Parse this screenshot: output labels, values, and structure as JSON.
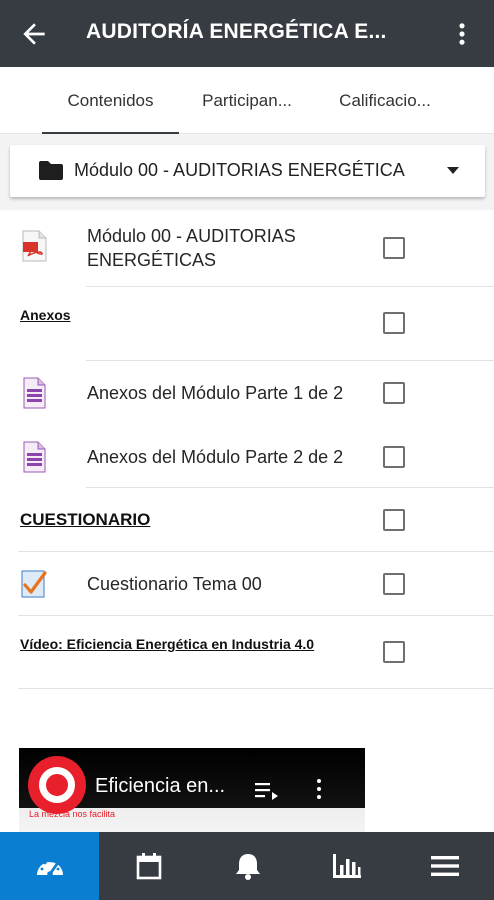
{
  "appbar": {
    "title": "AUDITORÍA ENERGÉTICA E...",
    "back_icon": "arrow-left-icon",
    "more_icon": "more-vertical-icon"
  },
  "tabs": [
    {
      "label": "Contenidos",
      "active": true
    },
    {
      "label": "Participan...",
      "active": false
    },
    {
      "label": "Calificacio...",
      "active": false
    }
  ],
  "section_selector": {
    "icon": "folder-icon",
    "label": "Módulo 00 - AUDITORIAS ENERGÉTICA",
    "caret_icon": "caret-down-icon"
  },
  "items": [
    {
      "type": "file",
      "icon": "pdf-file-icon",
      "line1": "Módulo 00 - AUDITORIAS",
      "line2": "ENERGÉTICAS",
      "checked": false
    },
    {
      "type": "label",
      "text": "Anexos",
      "checked": false
    },
    {
      "type": "file",
      "icon": "document-file-icon",
      "text": "Anexos del Módulo Parte 1 de 2",
      "checked": false
    },
    {
      "type": "file",
      "icon": "document-file-icon",
      "text": "Anexos del Módulo Parte 2 de 2",
      "checked": false
    },
    {
      "type": "label",
      "text": "CUESTIONARIO",
      "checked": false
    },
    {
      "type": "quiz",
      "icon": "quiz-check-icon",
      "text": "Cuestionario Tema 00",
      "checked": false
    },
    {
      "type": "label",
      "text": "Vídeo: Eficiencia Energética en Industria 4.0",
      "checked": false
    }
  ],
  "video": {
    "title": "Eficiencia en...",
    "tagline": "La mezcla nos facilita",
    "logo_icon": "channel-logo-icon",
    "playlist_icon": "playlist-icon",
    "more_icon": "more-vertical-icon"
  },
  "bottom_nav": [
    {
      "name": "dashboard",
      "icon": "dashboard-gauge-icon",
      "active": true
    },
    {
      "name": "calendar",
      "icon": "calendar-icon",
      "active": false
    },
    {
      "name": "notifications",
      "icon": "bell-icon",
      "active": false
    },
    {
      "name": "grades",
      "icon": "bar-chart-icon",
      "active": false
    },
    {
      "name": "menu",
      "icon": "hamburger-menu-icon",
      "active": false
    }
  ],
  "colors": {
    "appbar": "#373c42",
    "active_nav": "#0a7fd1",
    "pdf_red": "#d9342b",
    "doc_purple": "#8e44ad",
    "video_logo_red": "#e8202b"
  }
}
